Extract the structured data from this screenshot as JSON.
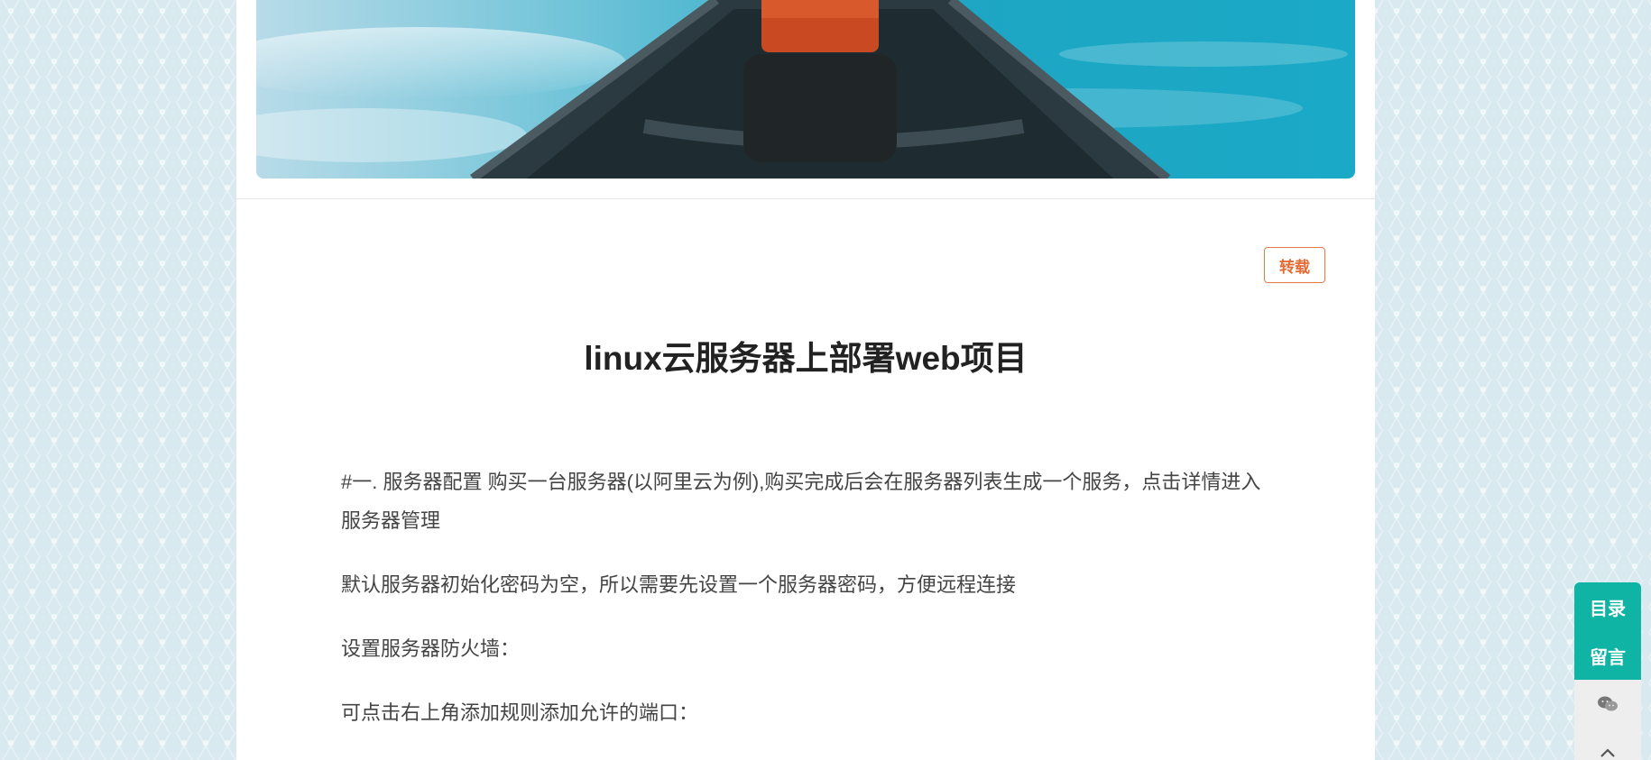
{
  "post": {
    "tag": "转载",
    "title": "linux云服务器上部署web项目",
    "paragraphs": [
      "#一. 服务器配置 购买一台服务器(以阿里云为例),购买完成后会在服务器列表生成一个服务，点击详情进入服务器管理",
      "默认服务器初始化密码为空，所以需要先设置一个服务器密码，方便远程连接",
      "设置服务器防火墙：",
      "可点击右上角添加规则添加允许的端口："
    ]
  },
  "float_toolbar": {
    "toc_label": "目录",
    "comment_label": "留言",
    "wechat_icon": "wechat-icon",
    "top_icon": "chevron-up-icon"
  },
  "colors": {
    "accent": "#0fb4a5",
    "tag": "#e36b34"
  }
}
